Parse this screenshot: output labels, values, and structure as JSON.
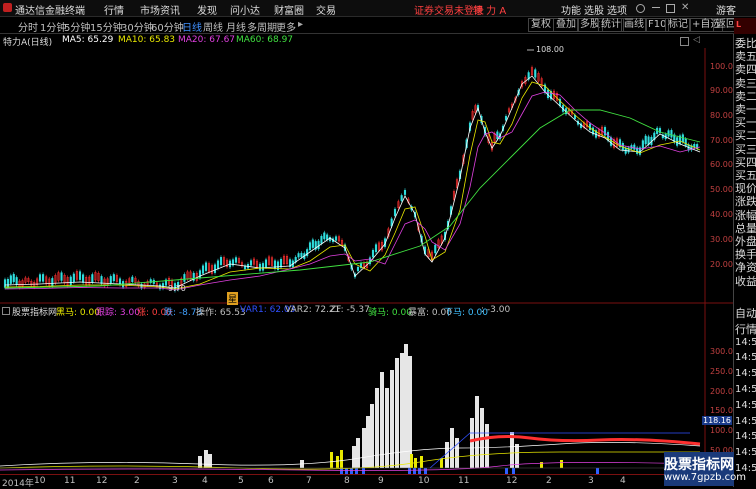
{
  "app": {
    "title": "通达信金融终端",
    "user_label": "游客"
  },
  "menu": [
    "行情",
    "市场",
    "资讯",
    "发现",
    "问小达",
    "财富圈",
    "交易"
  ],
  "notice": "证券交易未登录",
  "stock_tab": "特 力 A",
  "right_menu": [
    "功能",
    "选股",
    "选项"
  ],
  "periods": [
    "分时",
    "1分钟",
    "5分钟",
    "15分钟",
    "30分钟",
    "60分钟",
    "日线",
    "周线",
    "月线",
    "多周期",
    "更多"
  ],
  "active_period": "日线",
  "tools": [
    "复权",
    "叠加",
    "多股",
    "统计",
    "画线",
    "F10",
    "标记",
    "+自选",
    "返回"
  ],
  "main_chart": {
    "stock_label": "特力A(日线)",
    "ma": [
      {
        "label": "MA5: 65.29",
        "color": "#ffffff"
      },
      {
        "label": "MA10: 65.83",
        "color": "#e8e800"
      },
      {
        "label": "MA20: 67.67",
        "color": "#e040e0"
      },
      {
        "label": "MA60: 68.97",
        "color": "#40e040"
      }
    ],
    "high_label": "108.00",
    "low_label": "9.70",
    "y_ticks": [
      "100.0",
      "90.00",
      "80.00",
      "70.00",
      "60.00",
      "50.00",
      "40.00",
      "30.00",
      "20.00"
    ],
    "event_marker": "星"
  },
  "indicator": {
    "title": "股票指标网",
    "values": [
      {
        "label": "黑马: 0.00",
        "color": "#e8e800"
      },
      {
        "label": "跟踪: 3.00",
        "color": "#e040e0"
      },
      {
        "label": "涨: 0.00",
        "color": "#ff4040"
      },
      {
        "label": "跌: -8.73",
        "color": "#40a0ff"
      },
      {
        "label": "操作: 65.53",
        "color": "#c0c0c0"
      },
      {
        "label": "VAR1: 62.03",
        "color": "#3050ff"
      },
      {
        "label": "VAR2: 72.21",
        "color": "#c0c0c0"
      },
      {
        "label": "ZF: -5.37",
        "color": "#c0c0c0"
      },
      {
        "label": "骑马: 0.00",
        "color": "#40e040"
      },
      {
        "label": "暴富: 0.00",
        "color": "#c0c0c0"
      },
      {
        "label": "下马: 0.00",
        "color": "#40c0ff"
      },
      {
        "label": ": -3.00",
        "color": "#c0c0c0"
      }
    ],
    "y_ticks": [
      "300.0",
      "250.0",
      "200.0",
      "150.0",
      "100.0",
      "50.00",
      "0.00"
    ],
    "current_value": "118.16"
  },
  "right_panel": {
    "top": [
      "委比",
      "卖五",
      "卖四",
      "卖三",
      "卖二",
      "卖一",
      "买一",
      "买二",
      "买三",
      "买四",
      "买五",
      "现价",
      "涨跌",
      "涨幅",
      "总量",
      "外盘",
      "换手",
      "净资",
      "收益"
    ],
    "bottom": [
      "自动",
      "行情",
      "14:56",
      "14:56",
      "14:56",
      "14:56",
      "14:56",
      "14:56",
      "14:56",
      "14:56",
      "14:56"
    ]
  },
  "x_axis": [
    "2014年",
    "10",
    "11",
    "12",
    "2",
    "3",
    "4",
    "5",
    "6",
    "7",
    "8",
    "9",
    "10",
    "11",
    "12",
    "2",
    "3",
    "4"
  ],
  "watermark": {
    "title": "股票指标网",
    "url": "www.7gpzb.com"
  }
}
